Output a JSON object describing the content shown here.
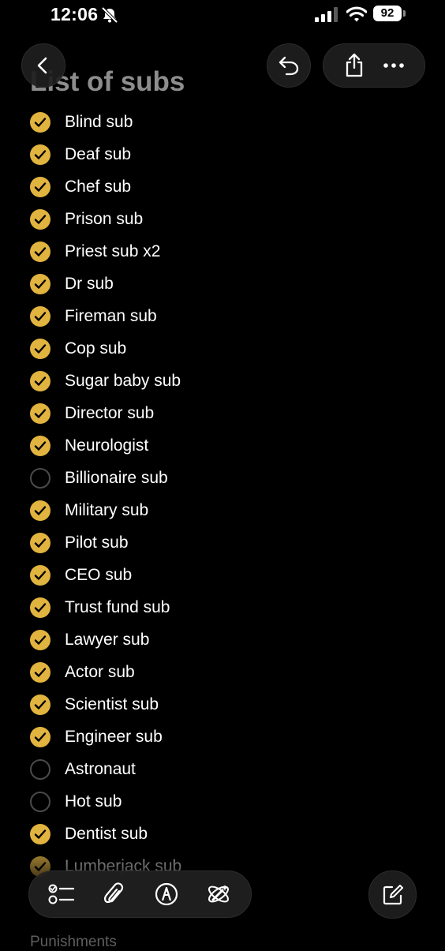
{
  "status_bar": {
    "time": "12:06",
    "battery": "92"
  },
  "note": {
    "title": "List of subs",
    "items": [
      {
        "label": "Blind sub",
        "checked": true
      },
      {
        "label": "Deaf sub",
        "checked": true
      },
      {
        "label": "Chef sub",
        "checked": true
      },
      {
        "label": "Prison sub",
        "checked": true
      },
      {
        "label": "Priest sub x2",
        "checked": true
      },
      {
        "label": "Dr sub",
        "checked": true
      },
      {
        "label": "Fireman sub",
        "checked": true
      },
      {
        "label": "Cop sub",
        "checked": true
      },
      {
        "label": "Sugar baby sub",
        "checked": true
      },
      {
        "label": "Director sub",
        "checked": true
      },
      {
        "label": "Neurologist",
        "checked": true
      },
      {
        "label": "Billionaire sub",
        "checked": false
      },
      {
        "label": "Military sub",
        "checked": true
      },
      {
        "label": "Pilot sub",
        "checked": true
      },
      {
        "label": "CEO sub",
        "checked": true
      },
      {
        "label": "Trust fund sub",
        "checked": true
      },
      {
        "label": "Lawyer sub",
        "checked": true
      },
      {
        "label": "Actor sub",
        "checked": true
      },
      {
        "label": "Scientist sub",
        "checked": true
      },
      {
        "label": "Engineer sub",
        "checked": true
      },
      {
        "label": "Astronaut",
        "checked": false
      },
      {
        "label": "Hot sub",
        "checked": false
      },
      {
        "label": "Dentist sub",
        "checked": true
      },
      {
        "label": "Lumberjack sub",
        "checked": true
      }
    ],
    "next_section_heading": "Punishments"
  },
  "colors": {
    "accent": "#e1b33f",
    "background": "#000000",
    "title": "#8d8d8d"
  },
  "icons": {
    "nav": [
      "chevron-left-icon",
      "undo-icon",
      "share-icon",
      "more-icon"
    ],
    "toolbar": [
      "checklist-icon",
      "paperclip-icon",
      "markup-pen-icon",
      "writing-tools-icon",
      "compose-icon"
    ]
  }
}
